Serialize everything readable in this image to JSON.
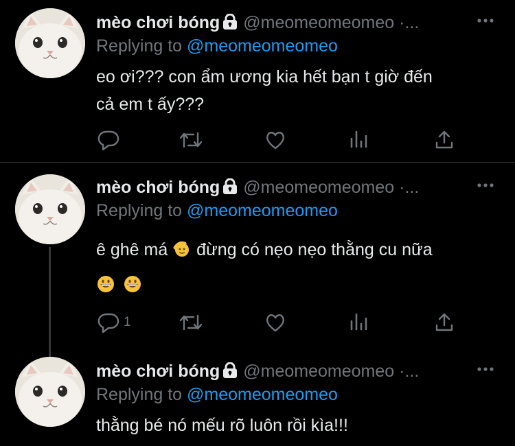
{
  "tweets": [
    {
      "name": "mèo chơi bóng",
      "handle": "@meomeomeomeo ·...",
      "replying_prefix": "Replying to",
      "replying_to": "@meomeomeomeo",
      "text_line1": "eo ơi??? con ẩm ương kia hết bạn t giờ đến",
      "text_line2": "cả em t ấy???",
      "reply_count": ""
    },
    {
      "name": "mèo chơi bóng",
      "handle": "@meomeomeomeo ·...",
      "replying_prefix": "Replying to",
      "replying_to": "@meomeomeomeo",
      "text_line1_a": "ê ghê má",
      "text_line1_b": "đừng có nẹo nẹo thằng cu nữa",
      "reply_count": "1"
    },
    {
      "name": "mèo chơi bóng",
      "handle": "@meomeomeomeo ·...",
      "replying_prefix": "Replying to",
      "replying_to": "@meomeomeomeo",
      "text_line1": "thằng bé nó mếu rõ luôn rồi kìa!!!"
    }
  ],
  "colors": {
    "background": "#000000",
    "text": "#e7e9ea",
    "muted": "#71767b",
    "link": "#1d9bf0",
    "divider": "#2f3336"
  },
  "icons": [
    "reply-icon",
    "retweet-icon",
    "like-icon",
    "analytics-icon",
    "share-icon",
    "lock-icon",
    "more-icon",
    "cat-avatar",
    "grinning-emoji",
    "saluting-face-emoji"
  ]
}
